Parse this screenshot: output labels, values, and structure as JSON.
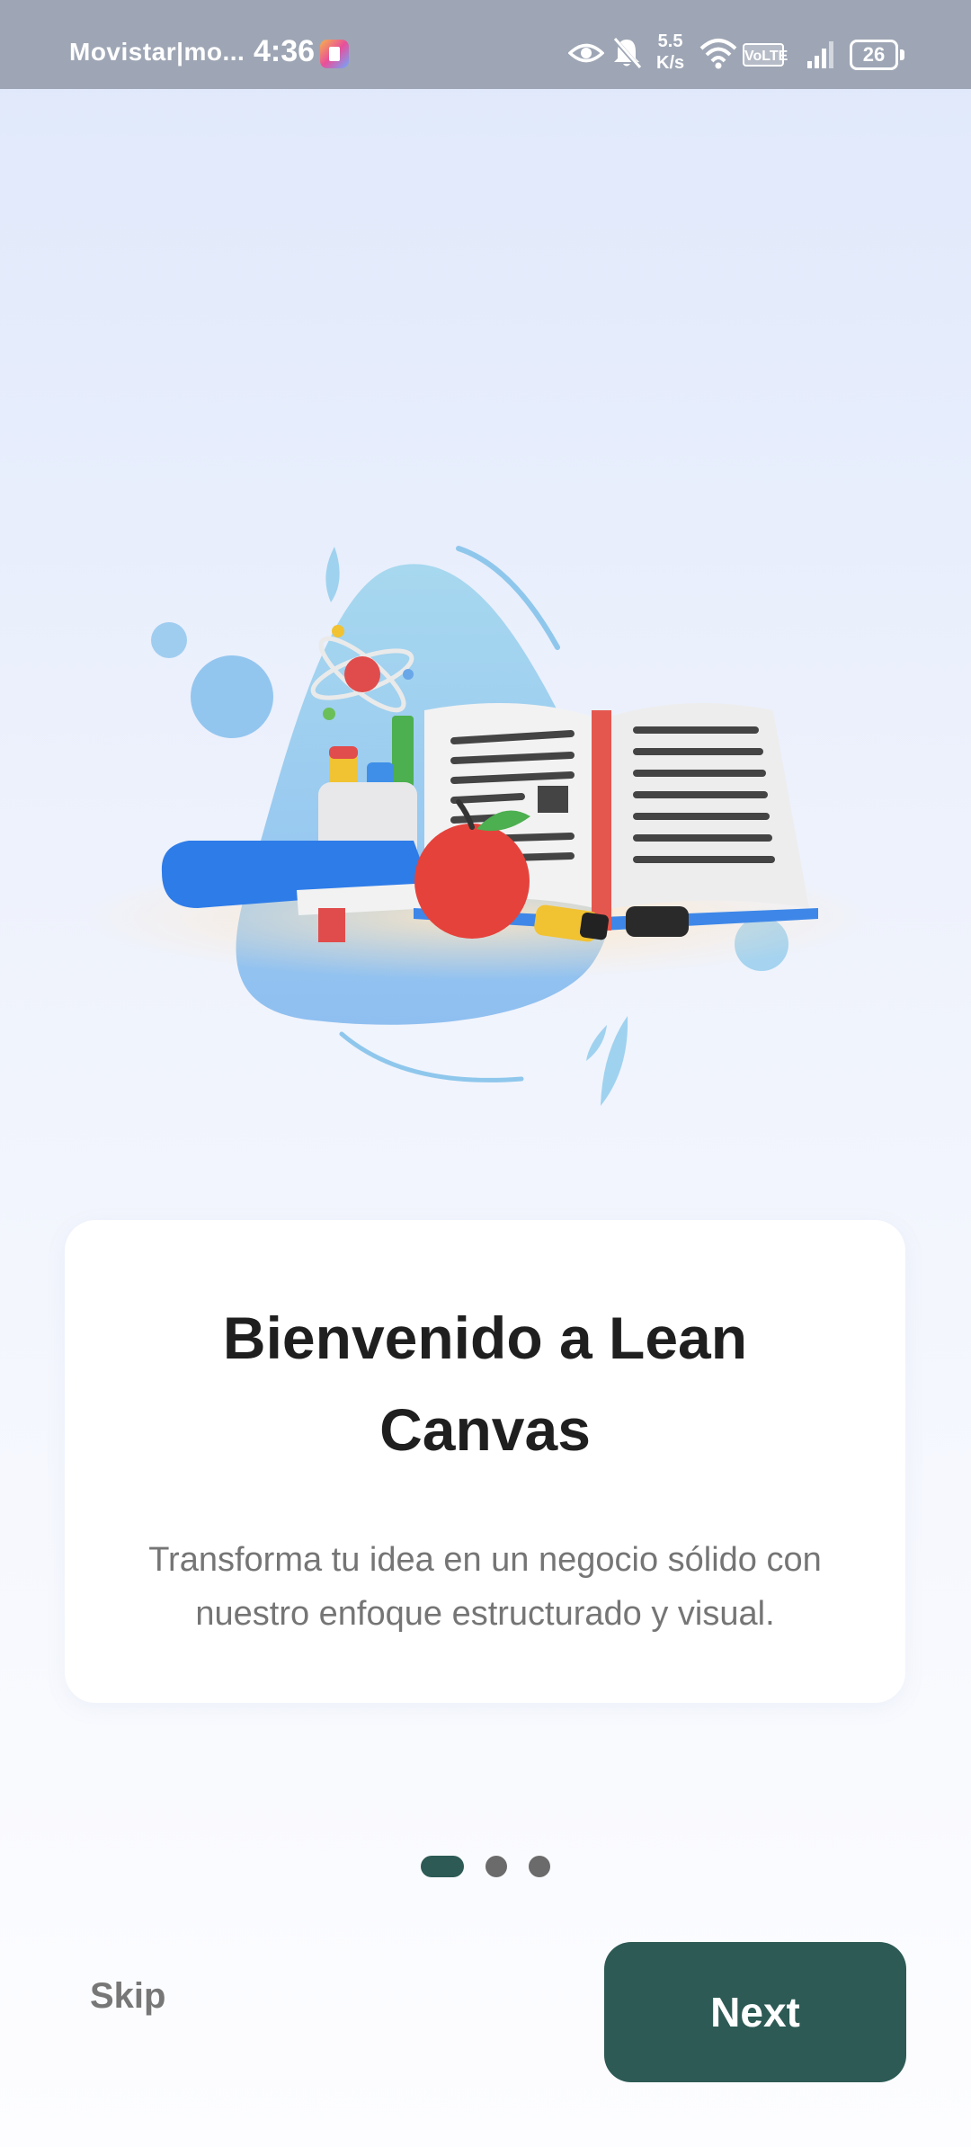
{
  "status_bar": {
    "carrier": "Movistar|mo...",
    "time": "4:36",
    "net_speed_value": "5.5",
    "net_speed_unit": "K/s",
    "volte": "VoLTE",
    "battery": "26"
  },
  "onboarding": {
    "title": "Bienvenido a Lean Canvas",
    "subtitle": "Transforma tu idea en un negocio sólido con nuestro enfoque estructurado y visual.",
    "illustration": "books-apple-atom-illustration",
    "page_count": 3,
    "current_page": 1
  },
  "actions": {
    "skip_label": "Skip",
    "next_label": "Next"
  },
  "colors": {
    "primary": "#2d5a55",
    "status_bar": "#9ea6b5",
    "background_top": "#dfe8fb",
    "dot_inactive": "#6b6b6b"
  }
}
